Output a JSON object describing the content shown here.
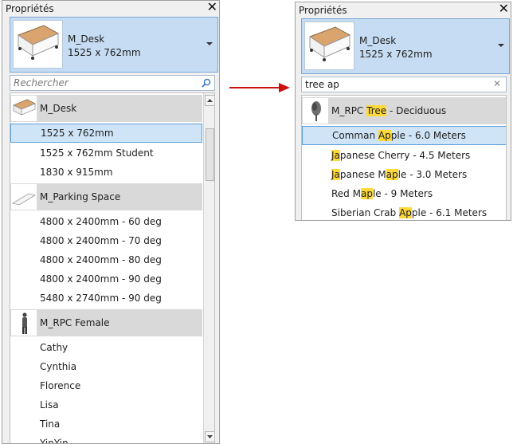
{
  "left": {
    "title": "Propriétés",
    "type_selector": {
      "family": "M_Desk",
      "type": "1525 x 762mm"
    },
    "search": {
      "value": "",
      "placeholder": "Rechercher"
    },
    "groups": [
      {
        "name": "M_Desk",
        "items": [
          "1525 x 762mm",
          "1525 x 762mm Student",
          "1830 x 915mm"
        ]
      },
      {
        "name": "M_Parking Space",
        "items": [
          "4800 x 2400mm - 60 deg",
          "4800 x 2400mm - 70 deg",
          "4800 x 2400mm - 80 deg",
          "4800 x 2400mm - 90 deg",
          "5480 x 2740mm - 90 deg"
        ]
      },
      {
        "name": "M_RPC Female",
        "items": [
          "Cathy",
          "Cynthia",
          "Florence",
          "Lisa",
          "Tina",
          "YinYin"
        ]
      }
    ],
    "selected_item": "1525 x 762mm"
  },
  "right": {
    "title": "Propriétés",
    "type_selector": {
      "family": "M_Desk",
      "type": "1525 x 762mm"
    },
    "search": {
      "value": "tree ap"
    },
    "group": {
      "name_before": "M_RPC ",
      "name_match": "Tree",
      "name_after": " - Deciduous"
    },
    "items": [
      {
        "pre": "Comman ",
        "match": "Ap",
        "post": "ple - 6.0 Meters"
      },
      {
        "pre": "",
        "match": "Ja",
        "post": "panese Cherry - 4.5 Meters"
      },
      {
        "pre": "",
        "match": "Ja",
        "match2_pre": "panese M",
        "match2": "ap",
        "post": "le - 3.0 Meters"
      },
      {
        "pre": "Red M",
        "match": "ap",
        "post": "le - 9 Meters"
      },
      {
        "pre": "Siberian Crab ",
        "match": "Ap",
        "post": "ple - 6.1 Meters"
      }
    ],
    "selected_index": 0
  },
  "arrow_color": "#cc1111",
  "highlight_color": "#ffd93a"
}
